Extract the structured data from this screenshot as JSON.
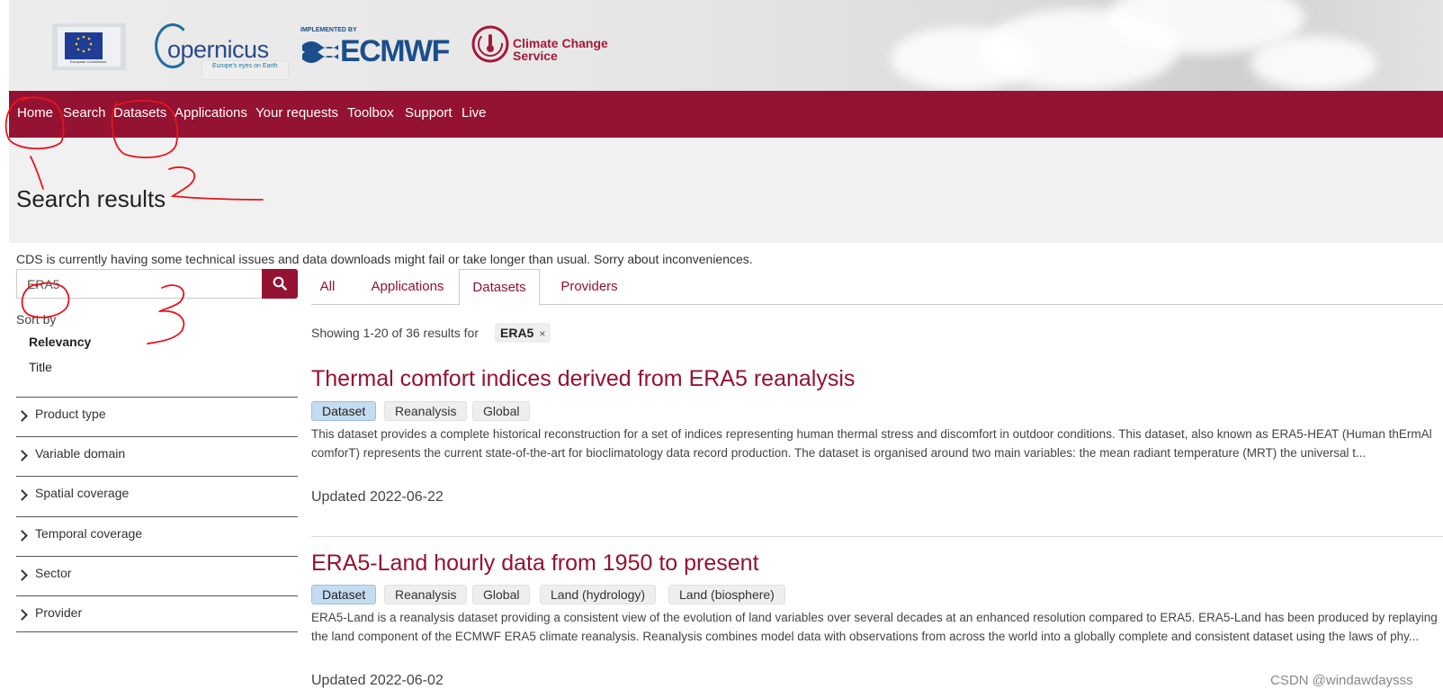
{
  "header": {
    "eu_logo_text": "European Commission",
    "copernicus_word": "opernicus",
    "copernicus_tagline": "Europe's eyes on Earth",
    "ecmwf_implemented_by": "IMPLEMENTED BY",
    "ecmwf_word": "ECMWF",
    "c3s_line1": "Climate Change",
    "c3s_line2": "Service"
  },
  "nav": {
    "items": [
      "Home",
      "Search",
      "Datasets",
      "Applications",
      "Your requests",
      "Toolbox",
      "Support",
      "Live"
    ]
  },
  "page": {
    "title": "Search results",
    "notice": "CDS is currently having some technical issues and data downloads might fail or take longer than usual. Sorry about inconveniences."
  },
  "search": {
    "value": "ERA5"
  },
  "sort": {
    "label": "Sort by",
    "options": [
      "Relevancy",
      "Title"
    ],
    "active": "Relevancy"
  },
  "facets": [
    "Product type",
    "Variable domain",
    "Spatial coverage",
    "Temporal coverage",
    "Sector",
    "Provider"
  ],
  "tabs": {
    "items": [
      "All",
      "Applications",
      "Datasets",
      "Providers"
    ],
    "active": "Datasets"
  },
  "results_summary": {
    "text": "Showing 1-20 of 36 results for",
    "query_chip": "ERA5",
    "remove_glyph": "×"
  },
  "results": [
    {
      "title": "Thermal comfort indices derived from ERA5 reanalysis",
      "tags": [
        "Dataset",
        "Reanalysis",
        "Global"
      ],
      "description": "This dataset provides a complete historical reconstruction for a set of indices representing human thermal stress and discomfort in outdoor conditions. This dataset, also known as ERA5-HEAT (Human thErmAl comforT) represents the current state-of-the-art for bioclimatology data record production. The dataset is organised around two main variables: the mean radiant temperature (MRT) the universal t...",
      "updated": "Updated 2022-06-22"
    },
    {
      "title": "ERA5-Land hourly data from 1950 to present",
      "tags": [
        "Dataset",
        "Reanalysis",
        "Global",
        "Land (hydrology)",
        "Land (biosphere)"
      ],
      "description": "ERA5-Land is a reanalysis dataset providing a consistent view of the evolution of land variables over several decades at an enhanced resolution compared to ERA5. ERA5-Land has been produced by replaying the land component of the ECMWF ERA5 climate reanalysis. Reanalysis combines model data with observations from across the world into a globally complete and consistent dataset using the laws of phy...",
      "updated": "Updated 2022-06-02"
    }
  ],
  "annotations": {
    "mark_1": "1",
    "mark_2": "2",
    "mark_3": "3",
    "color": "#e8141b"
  },
  "watermark": "CSDN @windawdaysss",
  "colors": {
    "brand": "#941232",
    "tag_primary": "#c5dcf0",
    "tag_default": "#eeeeee"
  }
}
